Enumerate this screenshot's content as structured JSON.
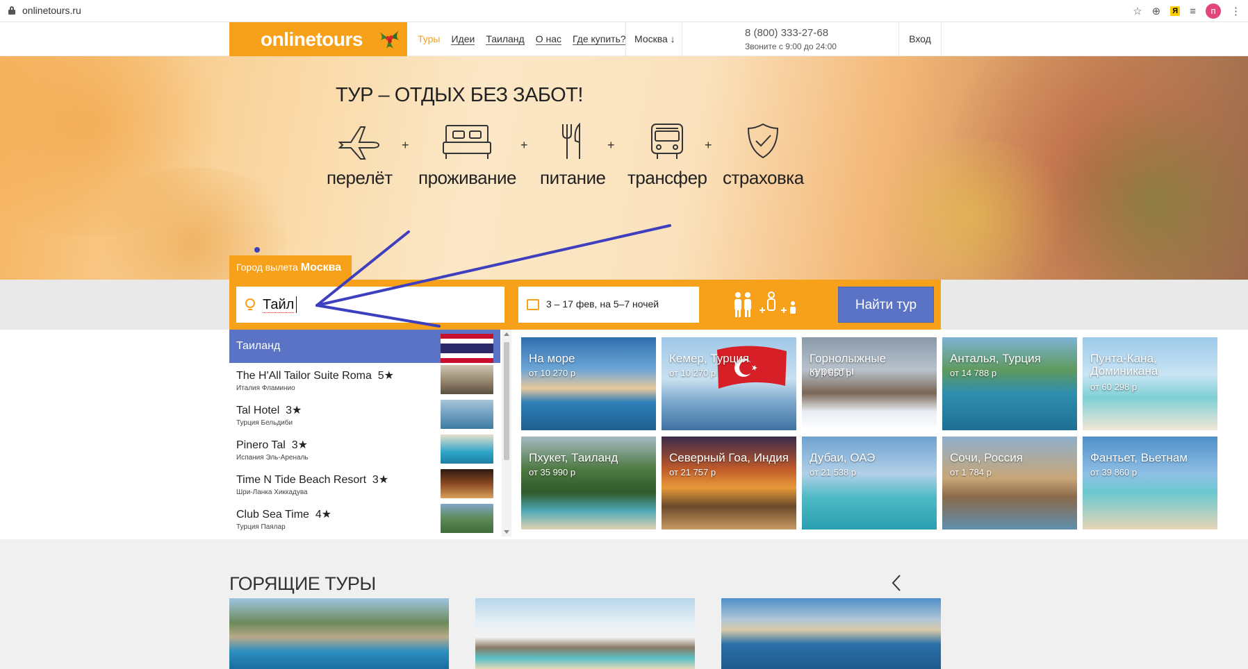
{
  "browser": {
    "url": "onlinetours.ru",
    "avatar_letter": "п"
  },
  "header": {
    "logo": "onlinetours",
    "nav": [
      "Туры",
      "Идеи",
      "Таиланд",
      "О нас",
      "Где купить?"
    ],
    "city": "Москва ↓",
    "phone": "8 (800) 333-27-68",
    "hours": "Звоните с 9:00 до 24:00",
    "login": "Вход"
  },
  "hero": {
    "title": "ТУР – ОТДЫХ БЕЗ ЗАБОТ!",
    "plus": "+",
    "features": [
      {
        "label": "перелёт",
        "icon": "plane-icon"
      },
      {
        "label": "проживание",
        "icon": "bed-icon"
      },
      {
        "label": "питание",
        "icon": "cutlery-icon"
      },
      {
        "label": "трансфер",
        "icon": "bus-icon"
      },
      {
        "label": "страховка",
        "icon": "shield-check-icon"
      }
    ]
  },
  "search": {
    "departure_label": "Город вылета",
    "departure_city": "Москва",
    "destination_value": "Тайл",
    "dates": "3 – 17 фев, на 5–7 ночей",
    "find_button": "Найти тур",
    "accent_color": "#f7a11a",
    "button_color": "#5a73c5"
  },
  "suggestions": {
    "country": "Таиланд",
    "hotels": [
      {
        "name": "The H'All Tailor Suite Roma",
        "stars": "5★",
        "location": "Италия Фламинио"
      },
      {
        "name": "Tal Hotel",
        "stars": "3★",
        "location": "Турция Бельдиби"
      },
      {
        "name": "Pinero Tal",
        "stars": "3★",
        "location": "Испания Эль-Ареналь"
      },
      {
        "name": "Time N Tide Beach Resort",
        "stars": "3★",
        "location": "Шри-Ланка Хиккадува"
      },
      {
        "name": "Club Sea Time",
        "stars": "4★",
        "location": "Турция Паялар"
      }
    ]
  },
  "destinations": [
    {
      "name": "На море",
      "price": "от 10 270 р"
    },
    {
      "name": "Кемер, Турция",
      "price": "от 10 270 р"
    },
    {
      "name": "Горнолыжные курорты",
      "price": "от 4 550 р"
    },
    {
      "name": "Анталья, Турция",
      "price": "от 14 788 р"
    },
    {
      "name": "Пунта-Кана, Доминикана",
      "price": "от 60 298 р"
    },
    {
      "name": "Пхукет, Таиланд",
      "price": "от 35 990 р"
    },
    {
      "name": "Северный Гоа, Индия",
      "price": "от 21 757 р"
    },
    {
      "name": "Дубаи, ОАЭ",
      "price": "от 21 538 р"
    },
    {
      "name": "Сочи, Россия",
      "price": "от 1 784 р"
    },
    {
      "name": "Фантьет, Вьетнам",
      "price": "от 39 860 р"
    }
  ],
  "hot_tours": {
    "title": "ГОРЯЩИЕ ТУРЫ"
  }
}
